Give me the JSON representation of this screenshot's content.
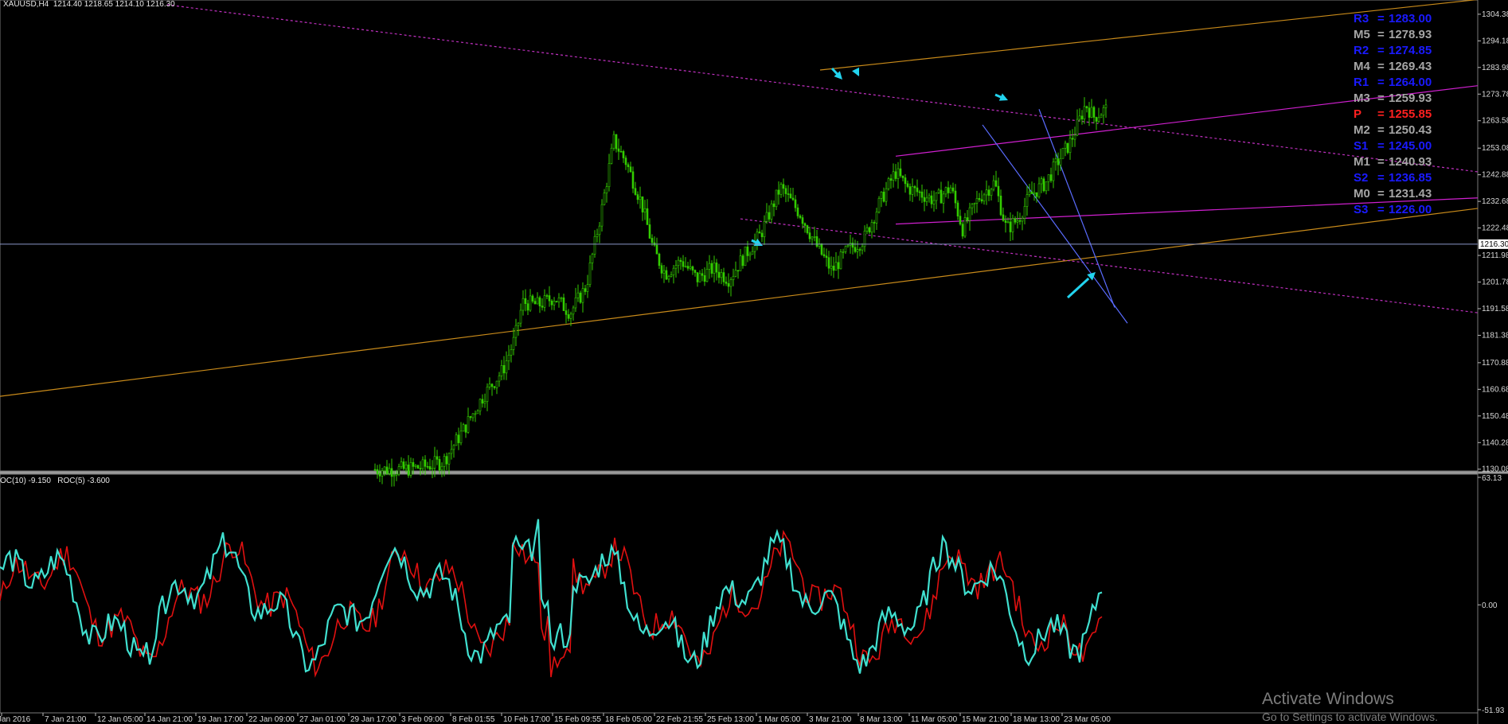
{
  "header": {
    "symbol": "XAUUSD,H4",
    "ohlc": "1214.40 1218.65 1214.10 1216.30"
  },
  "indicator_header": {
    "label1": "OC(10) -9.150",
    "label2": "ROC(5) -3.600"
  },
  "colors": {
    "background": "#000000",
    "candles": "#33cc00",
    "fan_orange": "#c88a1a",
    "magenta_channel": "#d020d0",
    "magenta_dotted": "#c030c0",
    "blue_trend": "#5a6cff",
    "arrows": "#22d3ee",
    "roc10": "#e01010",
    "roc5": "#40e0d0",
    "bid_line": "#8a96c8"
  },
  "pivots": [
    {
      "name": "R3",
      "value": "1283.00",
      "color": "#1a1aff"
    },
    {
      "name": "M5",
      "value": "1278.93",
      "color": "#a6a6a6"
    },
    {
      "name": "R2",
      "value": "1274.85",
      "color": "#1a1aff"
    },
    {
      "name": "M4",
      "value": "1269.43",
      "color": "#a6a6a6"
    },
    {
      "name": "R1",
      "value": "1264.00",
      "color": "#1a1aff"
    },
    {
      "name": "M3",
      "value": "1259.93",
      "color": "#a6a6a6"
    },
    {
      "name": "P",
      "value": "1255.85",
      "color": "#ff2020"
    },
    {
      "name": "M2",
      "value": "1250.43",
      "color": "#a6a6a6"
    },
    {
      "name": "S1",
      "value": "1245.00",
      "color": "#1a1aff"
    },
    {
      "name": "M1",
      "value": "1240.93",
      "color": "#a6a6a6"
    },
    {
      "name": "S2",
      "value": "1236.85",
      "color": "#1a1aff"
    },
    {
      "name": "M0",
      "value": "1231.43",
      "color": "#a6a6a6"
    },
    {
      "name": "S3",
      "value": "1226.00",
      "color": "#1a1aff"
    }
  ],
  "watermark": {
    "title": "Activate Windows",
    "subtitle": "Go to Settings to activate Windows."
  },
  "chart_data": [
    {
      "type": "candlestick",
      "title": "XAUUSD,H4",
      "ylim": [
        1130.0,
        1308.0
      ],
      "y_ticks": [
        "1304.38",
        "1294.18",
        "1283.98",
        "1273.78",
        "1263.58",
        "1253.08",
        "1242.88",
        "1232.68",
        "1222.48",
        "1211.98",
        "1201.78",
        "1191.58",
        "1181.38",
        "1170.88",
        "1160.68",
        "1150.48",
        "1140.28",
        "1130.08"
      ],
      "current_price": "1216.30",
      "x_ticks": [
        "Jan 2016",
        "7 Jan 21:00",
        "12 Jan 05:00",
        "14 Jan 21:00",
        "19 Jan 17:00",
        "22 Jan 09:00",
        "27 Jan 01:00",
        "29 Jan 17:00",
        "3 Feb 09:00",
        "8 Feb 01:55",
        "10 Feb 17:00",
        "15 Feb 09:55",
        "18 Feb 05:00",
        "22 Feb 21:55",
        "25 Feb 13:00",
        "1 Mar 05:00",
        "3 Mar 21:00",
        "8 Mar 13:00",
        "11 Mar 05:00",
        "15 Mar 21:00",
        "18 Mar 13:00",
        "23 Mar 05:00"
      ],
      "close_path": [
        [
          0,
          1130
        ],
        [
          0.05,
          1131
        ],
        [
          0.1,
          1133
        ],
        [
          0.15,
          1145
        ],
        [
          0.2,
          1158
        ],
        [
          0.25,
          1168
        ],
        [
          0.28,
          1180
        ],
        [
          0.3,
          1194
        ],
        [
          0.34,
          1193
        ],
        [
          0.38,
          1196
        ],
        [
          0.42,
          1190
        ],
        [
          0.46,
          1200
        ],
        [
          0.5,
          1230
        ],
        [
          0.53,
          1256
        ],
        [
          0.56,
          1248
        ],
        [
          0.6,
          1232
        ],
        [
          0.63,
          1214
        ],
        [
          0.66,
          1205
        ],
        [
          0.7,
          1210
        ],
        [
          0.74,
          1203
        ],
        [
          0.78,
          1207
        ],
        [
          0.82,
          1203
        ],
        [
          0.86,
          1212
        ],
        [
          0.9,
          1220
        ],
        [
          0.95,
          1238
        ],
        [
          1.0,
          1228
        ],
        [
          1.04,
          1216
        ],
        [
          1.08,
          1206
        ],
        [
          1.12,
          1214
        ],
        [
          1.16,
          1218
        ],
        [
          1.2,
          1232
        ],
        [
          1.24,
          1244
        ],
        [
          1.27,
          1238
        ],
        [
          1.3,
          1236
        ],
        [
          1.34,
          1233
        ],
        [
          1.38,
          1238
        ],
        [
          1.41,
          1222
        ],
        [
          1.45,
          1234
        ],
        [
          1.49,
          1240
        ],
        [
          1.52,
          1222
        ],
        [
          1.55,
          1226
        ],
        [
          1.58,
          1235
        ],
        [
          1.62,
          1240
        ],
        [
          1.65,
          1248
        ],
        [
          1.68,
          1255
        ],
        [
          1.7,
          1262
        ],
        [
          1.72,
          1270
        ],
        [
          1.74,
          1265
        ],
        [
          1.77,
          1268
        ],
        [
          1.8,
          1262
        ],
        [
          1.82,
          1270
        ],
        [
          1.84,
          1260
        ],
        [
          1.87,
          1252
        ],
        [
          1.9,
          1246
        ],
        [
          1.93,
          1250
        ],
        [
          1.96,
          1244
        ],
        [
          1.98,
          1262
        ],
        [
          2.0,
          1270
        ],
        [
          2.03,
          1262
        ],
        [
          2.06,
          1258
        ],
        [
          2.09,
          1252
        ],
        [
          2.12,
          1238
        ],
        [
          2.15,
          1230
        ],
        [
          2.18,
          1228
        ],
        [
          2.22,
          1230
        ],
        [
          2.26,
          1234
        ],
        [
          2.29,
          1250
        ],
        [
          2.32,
          1265
        ],
        [
          2.35,
          1262
        ],
        [
          2.38,
          1256
        ],
        [
          2.41,
          1250
        ],
        [
          2.44,
          1246
        ],
        [
          2.47,
          1244
        ],
        [
          2.5,
          1250
        ],
        [
          2.53,
          1256
        ],
        [
          2.56,
          1250
        ],
        [
          2.59,
          1244
        ],
        [
          2.62,
          1236
        ],
        [
          2.65,
          1226
        ],
        [
          2.68,
          1218
        ],
        [
          2.71,
          1216
        ],
        [
          2.74,
          1222
        ],
        [
          2.77,
          1216
        ],
        [
          2.8,
          1213
        ],
        [
          2.82,
          1216
        ]
      ],
      "trendlines": [
        "orange fan",
        "magenta channel",
        "magenta dotted",
        "blue trendline"
      ]
    },
    {
      "type": "line",
      "title": "OC(10) -9.150 ROC(5) -3.600",
      "ylim": [
        -51.93,
        63.13
      ],
      "y_ticks": [
        "63.13",
        "0.00",
        "-51.93"
      ],
      "series": [
        {
          "name": "OC(10)",
          "color": "#e01010"
        },
        {
          "name": "ROC(5)",
          "color": "#40e0d0"
        }
      ]
    }
  ]
}
